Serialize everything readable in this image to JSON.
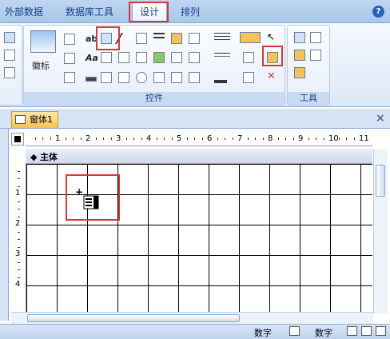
{
  "ribbon_tabs": [
    {
      "label": "外部数据"
    },
    {
      "label": "数据库工具"
    },
    {
      "label": "设计"
    },
    {
      "label": "排列"
    }
  ],
  "ribbon": {
    "logo_label": "徽标",
    "text_box_label": "ab",
    "label_control_label": "Aa",
    "controls_group_label": "控件",
    "tools_group_label": "工具"
  },
  "document": {
    "tab_label": "窗体1",
    "section_label": "主体",
    "close_symbol": "×",
    "h_ruler_numbers": [
      "1",
      "2",
      "3",
      "4",
      "5",
      "6",
      "7",
      "8",
      "9",
      "10",
      "11"
    ],
    "v_ruler_numbers": [
      "1",
      "2",
      "3",
      "4"
    ]
  },
  "statusbar": {
    "num_lock_left": "数字",
    "num_lock_right": "数字"
  },
  "cursor": {
    "symbol": "+"
  },
  "colors": {
    "highlight": "#d03a3a",
    "ribbon_text": "#15428b"
  }
}
